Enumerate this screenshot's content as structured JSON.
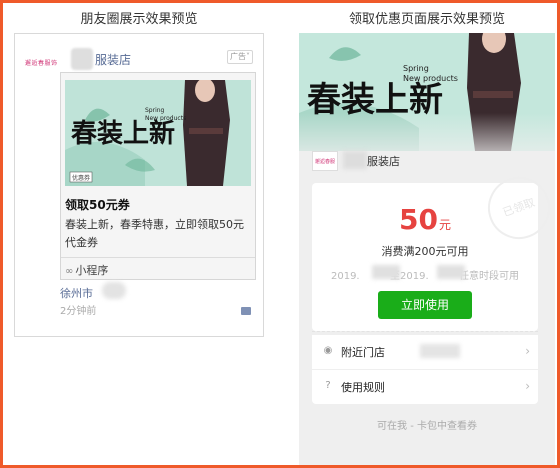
{
  "headings": {
    "left": "朋友圈展示效果预览",
    "right": "领取优惠页面展示效果预览"
  },
  "moments": {
    "logo_text": "邂逅春服饰",
    "shop_name": "服装店",
    "ad_label": "广告",
    "banner_text_main": "春装上新",
    "banner_text_en": "Spring New products",
    "banner_sticker": "优惠券",
    "title": "领取50元券",
    "description": "春装上新，春季特惠，立即领取50元代金券",
    "mini_program_label": "小程序",
    "city": "徐州市",
    "time": "2分钟前"
  },
  "coupon": {
    "banner_text_main": "春装上新",
    "banner_text_en": "Spring New products",
    "logo_text": "邂逅春服饰",
    "shop_name": "服装店",
    "stamp_text": "已领取",
    "amount": "50",
    "amount_unit": "元",
    "condition": "消费满200元可用",
    "validity_start": "2019.",
    "validity_mid": "至2019.",
    "validity_end": "任意时段可用",
    "use_button": "立即使用",
    "nearby_label": "附近门店",
    "rules_label": "使用规则",
    "footer": "可在我 - 卡包中查看券"
  },
  "colors": {
    "frame": "#ef5a2a",
    "link": "#576b95",
    "amount": "#e64340",
    "button": "#1aad19"
  }
}
